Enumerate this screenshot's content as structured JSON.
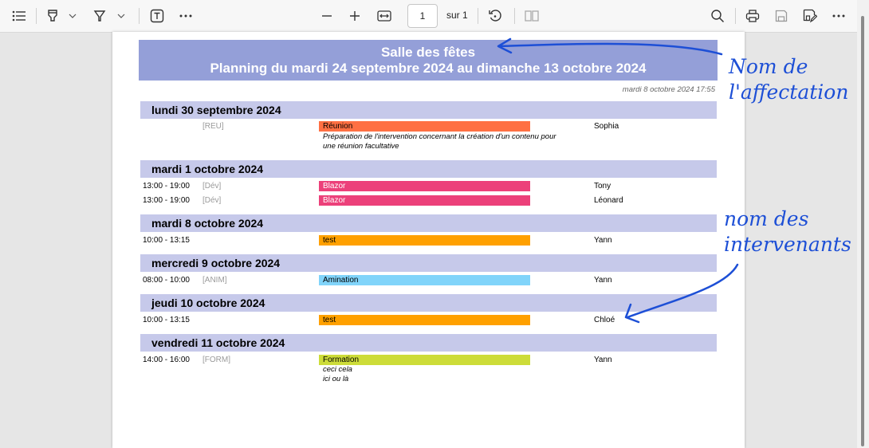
{
  "toolbar": {
    "page_number": "1",
    "page_of": "sur 1",
    "icons": [
      "table-of-contents-icon",
      "highlight-icon",
      "chevron-down-icon",
      "draw-icon",
      "chevron-down-icon",
      "text-box-icon",
      "more-icon",
      "zoom-out-icon",
      "zoom-in-icon",
      "fit-width-icon",
      "rotate-icon",
      "page-view-icon",
      "search-icon",
      "print-icon",
      "save-icon",
      "save-as-icon",
      "more-icon"
    ]
  },
  "document": {
    "title": "Salle des fêtes",
    "subtitle": "Planning du mardi 24 septembre 2024 au dimanche 13 octobre 2024",
    "timestamp": "mardi 8 octobre 2024 17:55",
    "days": [
      {
        "label": "lundi 30 septembre 2024",
        "entries": [
          {
            "time": "",
            "code": "[REU]",
            "activity": "Réunion",
            "color": "#ff7043",
            "person": "Sophia",
            "notes": [
              "Préparation de l'intervention concernant la création d'un contenu pour",
              "une réunion facultative"
            ]
          }
        ]
      },
      {
        "label": "mardi 1 octobre 2024",
        "entries": [
          {
            "time": "13:00 - 19:00",
            "code": "[Dév]",
            "activity": "Blazor",
            "color": "#ec407a",
            "text_color": "#ffffff",
            "person": "Tony"
          },
          {
            "time": "13:00 - 19:00",
            "code": "[Dév]",
            "activity": "Blazor",
            "color": "#ec407a",
            "text_color": "#ffffff",
            "person": "Léonard"
          }
        ]
      },
      {
        "label": "mardi 8 octobre 2024",
        "entries": [
          {
            "time": "10:00 - 13:15",
            "code": "",
            "activity": "test",
            "color": "#ffa000",
            "person": "Yann"
          }
        ]
      },
      {
        "label": "mercredi 9 octobre 2024",
        "entries": [
          {
            "time": "08:00 - 10:00",
            "code": "[ANIM]",
            "activity": "Amination",
            "color": "#81d4fa",
            "person": "Yann"
          }
        ]
      },
      {
        "label": "jeudi 10 octobre 2024",
        "entries": [
          {
            "time": "10:00 - 13:15",
            "code": "",
            "activity": "test",
            "color": "#ffa000",
            "person": "Chloé"
          }
        ]
      },
      {
        "label": "vendredi 11 octobre 2024",
        "entries": [
          {
            "time": "14:00 - 16:00",
            "code": "[FORM]",
            "activity": "Formation",
            "color": "#cddc39",
            "person": "Yann",
            "notes": [
              "ceci cela",
              "ici ou là"
            ]
          }
        ]
      }
    ]
  },
  "annotations": {
    "assignment_line1": "Nom de",
    "assignment_line2": "l'affectation",
    "speakers_line1": "nom des",
    "speakers_line2": "intervenants",
    "color": "#1d4fd6"
  }
}
